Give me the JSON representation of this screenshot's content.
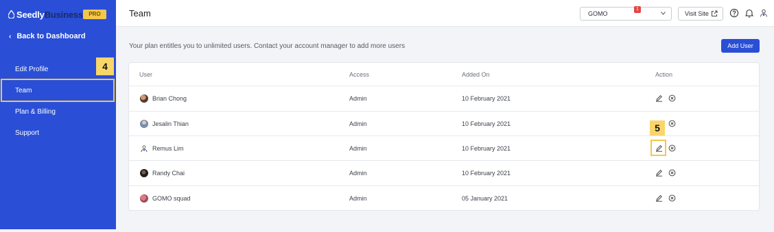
{
  "sidebar": {
    "brand_part1": "Seedly",
    "brand_part2": "Business",
    "pro_label": "PRO",
    "back_label": "Back to Dashboard",
    "items": [
      {
        "label": "Edit Profile"
      },
      {
        "label": "Team"
      },
      {
        "label": "Plan & Billing"
      },
      {
        "label": "Support"
      }
    ]
  },
  "header": {
    "title": "Team",
    "org_selected": "GOMO",
    "visit_site_label": "Visit Site",
    "notification_count": "1"
  },
  "main": {
    "plan_text": "Your plan entitles you to unlimited users. Contact your account manager to add more users",
    "add_user_label": "Add User",
    "columns": [
      "User",
      "Access",
      "Added On",
      "Action"
    ],
    "rows": [
      {
        "user": "Brian Chong",
        "access": "Admin",
        "added_on": "10 February 2021"
      },
      {
        "user": "Jesalin Thian",
        "access": "Admin",
        "added_on": "10 February 2021"
      },
      {
        "user": "Remus Lim",
        "access": "Admin",
        "added_on": "10 February 2021"
      },
      {
        "user": "Randy Chai",
        "access": "Admin",
        "added_on": "10 February 2021"
      },
      {
        "user": "GOMO squad",
        "access": "Admin",
        "added_on": "05 January 2021"
      }
    ]
  },
  "callouts": {
    "team_step": "4",
    "edit_step": "5"
  },
  "colors": {
    "sidebar": "#2a4fd6",
    "accent": "#2a4fd6",
    "highlight": "#f4c64b",
    "badge": "#e54545"
  },
  "icons": [
    "seedly-drop-icon",
    "chevron-left-icon",
    "chevron-down-icon",
    "external-link-icon",
    "help-icon",
    "bell-icon",
    "user-icon",
    "edit-icon",
    "remove-icon"
  ]
}
